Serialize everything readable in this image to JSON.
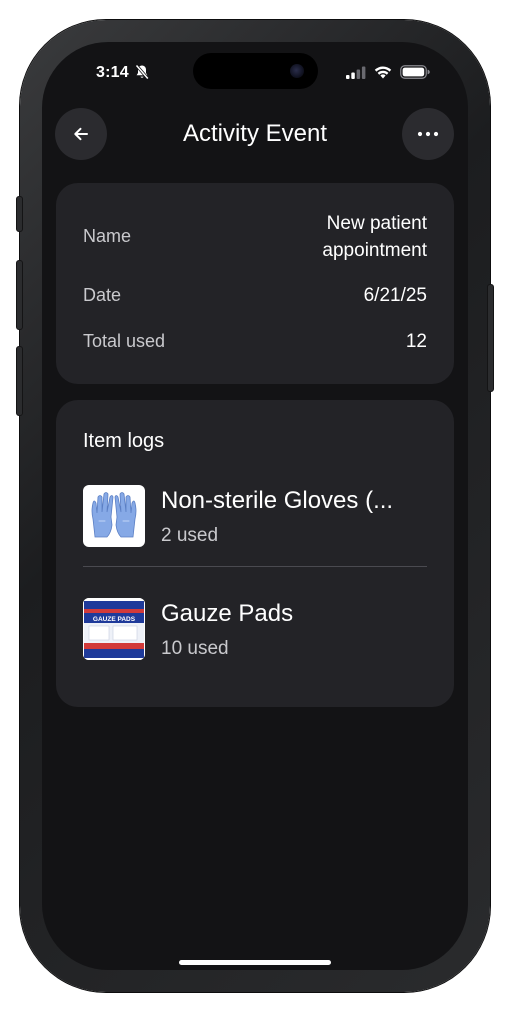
{
  "status_bar": {
    "time": "3:14",
    "icons": [
      "bell-slash-icon",
      "cellular-signal-icon",
      "wifi-icon",
      "battery-icon"
    ]
  },
  "header": {
    "title": "Activity Event",
    "back_icon": "arrow-left-icon",
    "more_icon": "ellipsis-icon"
  },
  "details": {
    "rows": [
      {
        "label": "Name",
        "value_line1": "New patient",
        "value_line2": "appointment"
      },
      {
        "label": "Date",
        "value": "6/21/25"
      },
      {
        "label": "Total used",
        "value": "12"
      }
    ]
  },
  "item_logs": {
    "title": "Item logs",
    "items": [
      {
        "name": "Non-sterile Gloves (...",
        "used": "2 used",
        "thumb_icon": "gloves-icon"
      },
      {
        "name": "Gauze Pads",
        "used": "10 used",
        "thumb_icon": "gauze-pads-box-icon",
        "thumb_label": "GAUZE PADS"
      }
    ]
  },
  "colors": {
    "background": "#131315",
    "card": "#232327",
    "text_primary": "#ffffff",
    "text_secondary": "#c9c9cd"
  }
}
